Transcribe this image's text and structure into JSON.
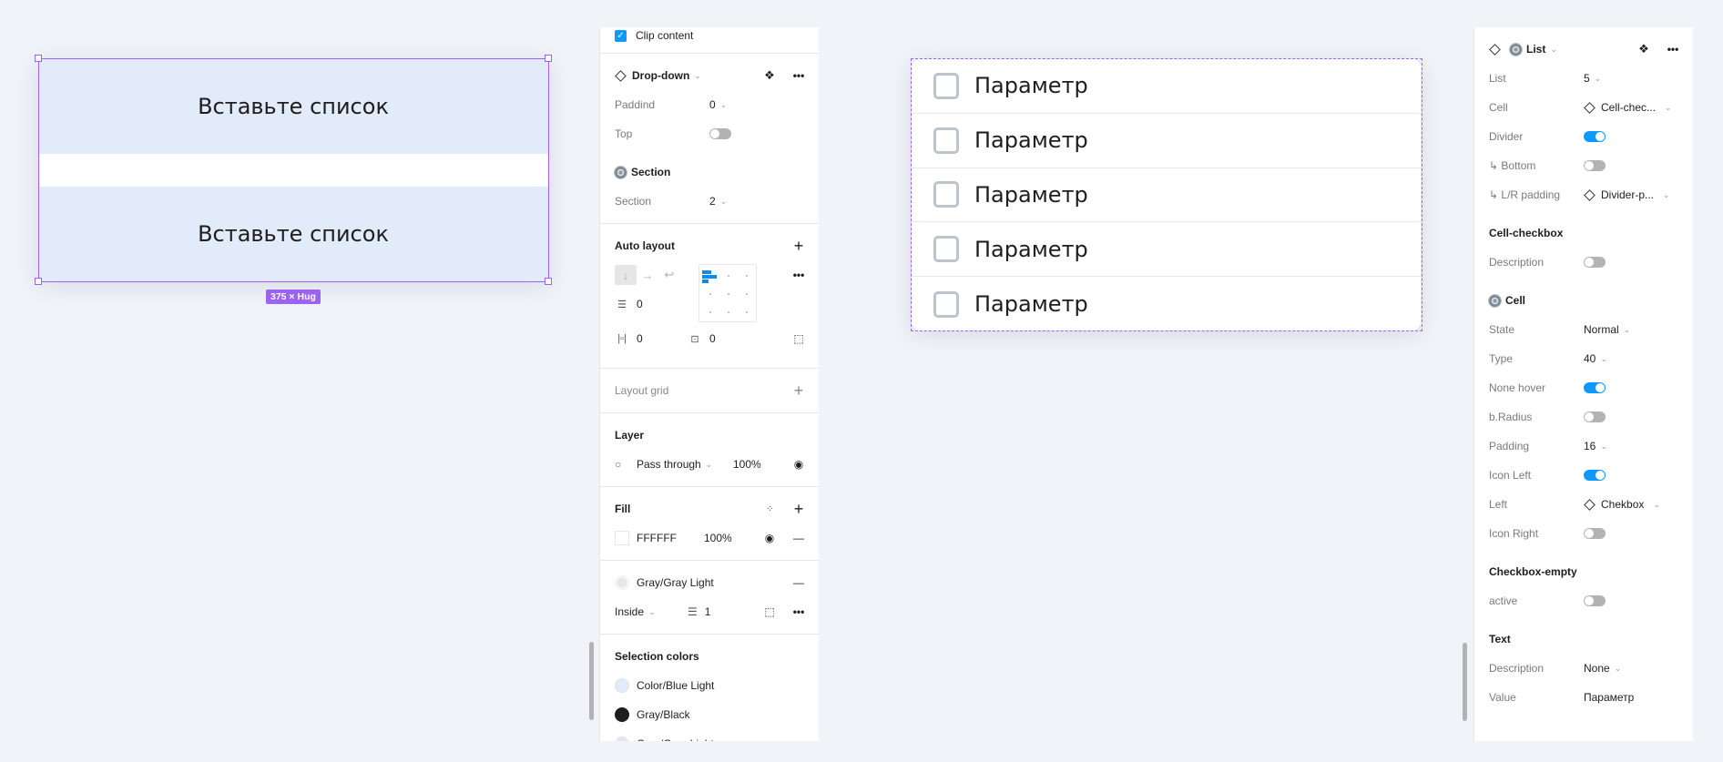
{
  "canvas": {
    "frame1": {
      "blocks": [
        "Вставьте список",
        "Вставьте список"
      ],
      "size_badge": "375 × Hug",
      "colors": {
        "block": "#e2ebfa",
        "selection": "#9b63f2"
      }
    },
    "frame2": {
      "items": [
        "Параметр",
        "Параметр",
        "Параметр",
        "Параметр",
        "Параметр"
      ]
    }
  },
  "left_panel": {
    "clip_content": {
      "label": "Clip content",
      "checked": true
    },
    "component": {
      "name": "Drop-down",
      "props": [
        {
          "label": "Paddind",
          "value": "0"
        },
        {
          "label": "Top",
          "toggle": false
        }
      ]
    },
    "section_group": {
      "name": "Section",
      "props": [
        {
          "label": "Section",
          "value": "2"
        }
      ]
    },
    "auto_layout": {
      "title": "Auto layout",
      "direction": "vertical",
      "spacing": "0",
      "h_padding": "0",
      "v_padding": "0"
    },
    "layout_grid": {
      "title": "Layout grid"
    },
    "layer": {
      "title": "Layer",
      "blend": "Pass through",
      "opacity": "100%"
    },
    "fill": {
      "title": "Fill",
      "hex": "FFFFFF",
      "opacity": "100%"
    },
    "stroke": {
      "style": "Gray/Gray Light",
      "position": "Inside",
      "weight": "1"
    },
    "selection_colors": {
      "title": "Selection colors",
      "items": [
        {
          "name": "Color/Blue Light",
          "color": "#e2ebfa"
        },
        {
          "name": "Gray/Black",
          "color": "#1e1e1e"
        },
        {
          "name": "Gray/Gray Light",
          "color": "#e3e6ea"
        }
      ]
    }
  },
  "right_panel": {
    "component": {
      "name": "List"
    },
    "list_props": [
      {
        "label": "List",
        "value": "5"
      },
      {
        "label": "Cell",
        "value": "Cell-chec...",
        "instance": true
      },
      {
        "label": "Divider",
        "toggle": true
      },
      {
        "label": "↳ Bottom",
        "toggle": false
      },
      {
        "label": "↳ L/R padding",
        "value": "Divider-p...",
        "instance": true
      }
    ],
    "cell_checkbox": {
      "title": "Cell-checkbox",
      "props": [
        {
          "label": "Description",
          "toggle": false
        }
      ]
    },
    "cell": {
      "title": "Cell",
      "props": [
        {
          "label": "State",
          "value": "Normal"
        },
        {
          "label": "Type",
          "value": "40"
        },
        {
          "label": "None hover",
          "toggle": true
        },
        {
          "label": "b.Radius",
          "toggle": false
        },
        {
          "label": "Padding",
          "value": "16"
        },
        {
          "label": "Icon Left",
          "toggle": true
        },
        {
          "label": "Left",
          "value": "Chekbox",
          "instance": true
        },
        {
          "label": "Icon Right",
          "toggle": false
        }
      ]
    },
    "checkbox_empty": {
      "title": "Checkbox-empty",
      "props": [
        {
          "label": "active",
          "toggle": false
        }
      ]
    },
    "text": {
      "title": "Text",
      "props": [
        {
          "label": "Description",
          "value": "None"
        },
        {
          "label": "Value",
          "value": "Параметр"
        }
      ]
    }
  }
}
